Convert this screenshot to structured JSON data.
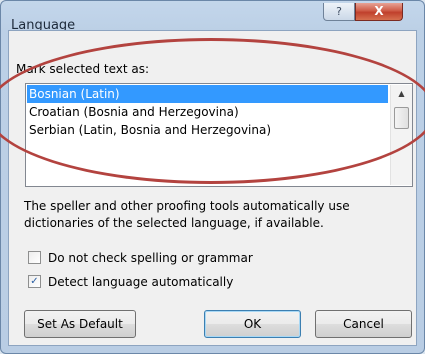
{
  "window": {
    "title": "Language",
    "help_label": "?",
    "close_label": "X"
  },
  "mark_label": "Mark selected text as:",
  "languages": [
    "Bosnian (Latin)",
    "Croatian (Bosnia and Herzegovina)",
    "Serbian (Latin, Bosnia and Herzegovina)"
  ],
  "selected_index": 0,
  "description": "The speller and other proofing tools automatically use dictionaries of the selected language, if available.",
  "options": [
    {
      "label": "Do not check spelling or grammar",
      "checked": false
    },
    {
      "label": "Detect language automatically",
      "checked": true
    }
  ],
  "buttons": {
    "set_default": "Set As Default",
    "ok": "OK",
    "cancel": "Cancel"
  },
  "colors": {
    "selection": "#3399ff",
    "annotation": "#b3433f"
  },
  "icons": {
    "scroll_up": "▲",
    "check": "✓"
  }
}
